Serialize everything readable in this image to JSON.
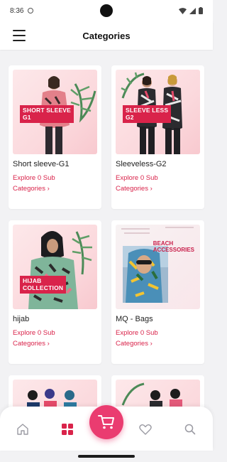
{
  "status_bar": {
    "time": "8:36"
  },
  "header": {
    "title": "Categories"
  },
  "colors": {
    "accent": "#d9234a",
    "cart_fab": "#ea3c70",
    "active_nav": "#d9234a"
  },
  "categories": [
    {
      "name": "Short sleeve-G1",
      "link": "Explore 0 Sub\nCategories ›",
      "image_label": "SHORT SLEEVE\nG1"
    },
    {
      "name": "Sleeveless-G2",
      "link": "Explore 0 Sub\nCategories ›",
      "image_label": "SLEEVE LESS\nG2"
    },
    {
      "name": "hijab",
      "link": "Explore 0 Sub\nCategories ›",
      "image_label": "HIJAB\nCOLLECTION"
    },
    {
      "name": "MQ - Bags",
      "link": "Explore 0 Sub\nCategories ›",
      "image_label": "BEACH\nACCESSORIES"
    }
  ],
  "bottom_nav": {
    "items": [
      {
        "icon": "home-icon",
        "active": false
      },
      {
        "icon": "grid-icon",
        "active": true
      },
      {
        "icon": "cart-icon",
        "active": false
      },
      {
        "icon": "heart-icon",
        "active": false
      },
      {
        "icon": "search-icon",
        "active": false
      }
    ]
  }
}
